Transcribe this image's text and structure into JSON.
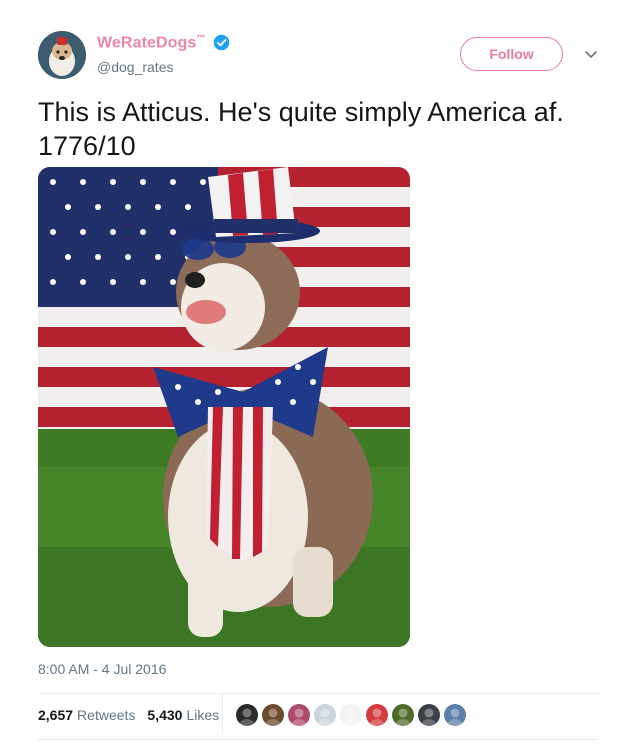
{
  "author": {
    "name": "WeRateDogs",
    "trademark": "™",
    "handle": "@dog_rates",
    "verified_icon": "verified-badge-icon",
    "follow_label": "Follow",
    "menu_icon": "chevron-down-icon"
  },
  "tweet": {
    "line1": "This is Atticus. He's quite simply America af.",
    "line2": "1776/10",
    "media_icon": "photo-dog-in-patriotic-costume",
    "timestamp": "8:00 AM - 4 Jul 2016"
  },
  "stats": {
    "retweets_count": "2,657",
    "retweets_label": "Retweets",
    "likes_count": "5,430",
    "likes_label": "Likes"
  },
  "likers": [
    {
      "icon": "liker-avatar-1",
      "color": "#2b2b2b"
    },
    {
      "icon": "liker-avatar-2",
      "color": "#6b4a2e"
    },
    {
      "icon": "liker-avatar-3",
      "color": "#b04a6a"
    },
    {
      "icon": "liker-avatar-4",
      "color": "#c9d4dc"
    },
    {
      "icon": "liker-avatar-5",
      "color": "#f2f2f2"
    },
    {
      "icon": "liker-avatar-6",
      "color": "#d23c3c"
    },
    {
      "icon": "liker-avatar-7",
      "color": "#4f6b2a"
    },
    {
      "icon": "liker-avatar-8",
      "color": "#3b3f46"
    },
    {
      "icon": "liker-avatar-9",
      "color": "#5a7fa8"
    }
  ],
  "colors": {
    "accent": "#e0245e",
    "verified": "#1da1f2",
    "muted_text": "#657786"
  }
}
